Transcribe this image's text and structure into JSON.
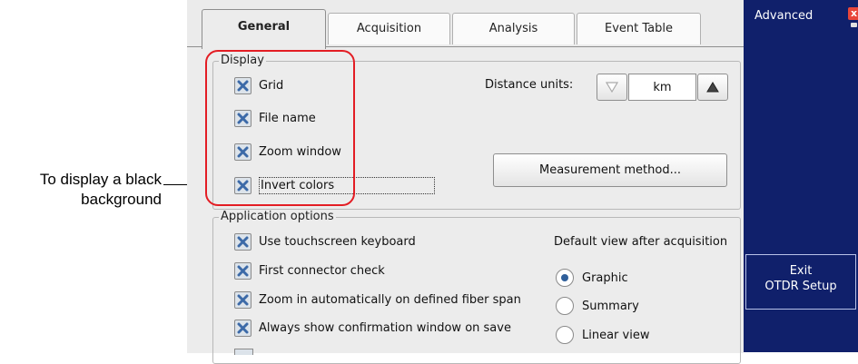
{
  "callout": {
    "line1": "To display a black",
    "line2": "background"
  },
  "tabs": [
    {
      "label": "General",
      "active": true
    },
    {
      "label": "Acquisition",
      "active": false
    },
    {
      "label": "Analysis",
      "active": false
    },
    {
      "label": "Event Table",
      "active": false
    }
  ],
  "display": {
    "title": "Display",
    "options": [
      {
        "label": "Grid",
        "checked": true
      },
      {
        "label": "File name",
        "checked": true
      },
      {
        "label": "Zoom window",
        "checked": true
      },
      {
        "label": "Invert colors",
        "checked": true
      }
    ],
    "distance_label": "Distance units:",
    "distance_value": "km",
    "measurement_button": "Measurement method..."
  },
  "app_options": {
    "title": "Application options",
    "options": [
      {
        "label": "Use touchscreen keyboard",
        "checked": true
      },
      {
        "label": "First connector check",
        "checked": true
      },
      {
        "label": "Zoom in automatically on defined fiber span",
        "checked": true
      },
      {
        "label": "Always show confirmation window on save",
        "checked": true
      }
    ],
    "default_view_label": "Default view after acquisition",
    "views": [
      {
        "label": "Graphic",
        "selected": true
      },
      {
        "label": "Summary",
        "selected": false
      },
      {
        "label": "Linear view",
        "selected": false
      }
    ]
  },
  "side_panel": {
    "title": "Advanced",
    "close_glyph": "x",
    "exit_line1": "Exit",
    "exit_line2": "OTDR Setup"
  },
  "colors": {
    "highlight": "#e31d24",
    "side_panel": "#10206b",
    "check_mark": "#3c6aa8",
    "radio_selected": "#2f5f9a"
  }
}
